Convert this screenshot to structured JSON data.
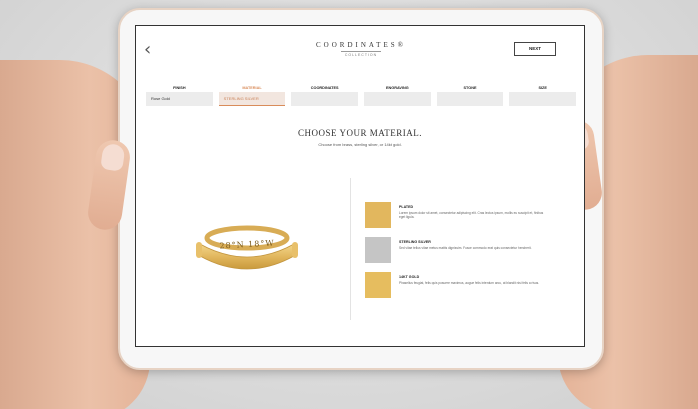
{
  "app": {
    "brand_name": "COORDINATES",
    "brand_mark": "®",
    "brand_subtitle": "COLLECTION",
    "back_icon": "chevron-left-icon",
    "next_label": "NEXT"
  },
  "tabs": [
    {
      "label": "FINISH",
      "value": "Rose Gold",
      "active": false
    },
    {
      "label": "MATERIAL",
      "value": "STERLING SILVER",
      "active": true
    },
    {
      "label": "COORDINATES",
      "value": "",
      "active": false
    },
    {
      "label": "ENGRAVING",
      "value": "",
      "active": false
    },
    {
      "label": "STONE",
      "value": "",
      "active": false
    },
    {
      "label": "SIZE",
      "value": "",
      "active": false
    }
  ],
  "main": {
    "heading": "CHOOSE YOUR MATERIAL.",
    "subheading": "Choose from brass, sterling silver, or 14kt gold.",
    "product_engraving": "28°N 18°W"
  },
  "materials": [
    {
      "title": "PLATED",
      "description": "Lorem ipsum dolor sit amet, consectetur adipiscing elit. Cras lectus ipsum, mollis eu suscipit et, finibus eget ligula.",
      "swatch": "#e2b75e"
    },
    {
      "title": "STERLING SILVER",
      "description": "Sed vitae tellus vitae metus mattis dignissim. Fusce commodo erat quis consectetur hendrerit.",
      "swatch": "#c5c5c5"
    },
    {
      "title": "14KT GOLD",
      "description": "Phasellus feugiat, felis quis posuere maximus, augue felis interdum arcu, at blandit nisi felis a risus.",
      "swatch": "#e6bd5f"
    }
  ],
  "colors": {
    "accent": "#d98c5a",
    "gold": "#e2b75e",
    "silver": "#c5c5c5"
  }
}
